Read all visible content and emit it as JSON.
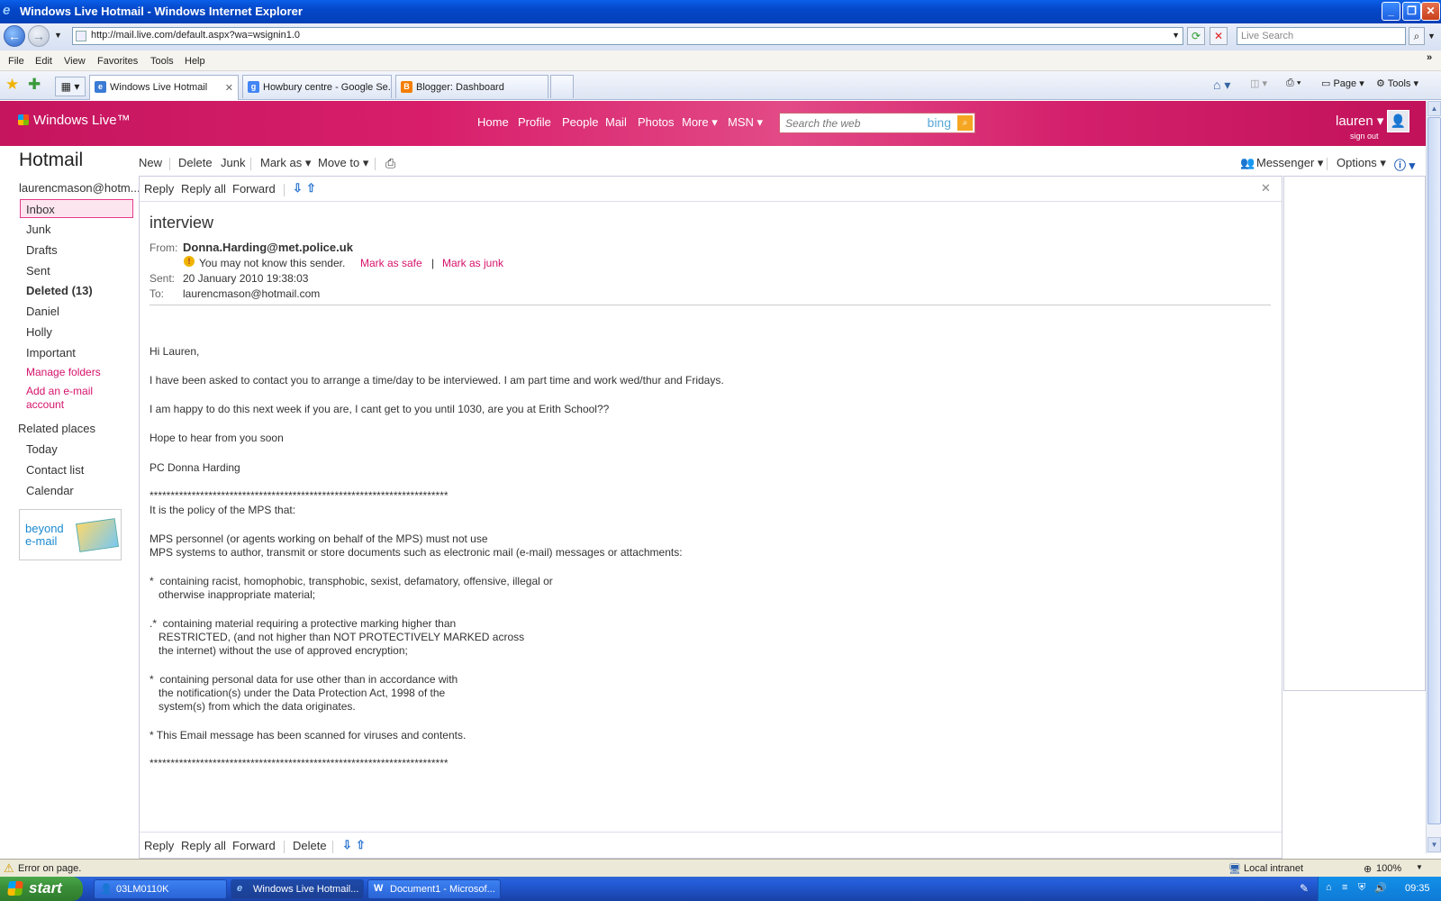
{
  "window": {
    "title": "Windows Live Hotmail - Windows Internet Explorer"
  },
  "address_bar": {
    "url": "http://mail.live.com/default.aspx?wa=wsignin1.0",
    "search_placeholder": "Live Search"
  },
  "menu": [
    "File",
    "Edit",
    "View",
    "Favorites",
    "Tools",
    "Help"
  ],
  "tabs": [
    {
      "label": "Windows Live Hotmail",
      "active": true
    },
    {
      "label": "Howbury centre - Google Se...",
      "active": false
    },
    {
      "label": "Blogger: Dashboard",
      "active": false
    }
  ],
  "ie_tools": {
    "page": "Page",
    "tools": "Tools"
  },
  "header": {
    "brand": "Windows Live™",
    "nav": [
      "Home",
      "Profile",
      "People",
      "Mail",
      "Photos",
      "More ▾",
      "MSN ▾"
    ],
    "search_placeholder": "Search the web",
    "bing": "bing",
    "user": "lauren ▾",
    "sign_out": "sign out"
  },
  "sidebar": {
    "title": "Hotmail",
    "account": "laurencmason@hotm...",
    "folders": [
      "Inbox",
      "Junk",
      "Drafts",
      "Sent",
      "Deleted (13)",
      "Daniel",
      "Holly",
      "Important"
    ],
    "links": [
      "Manage folders",
      "Add an e-mail",
      "account"
    ],
    "related_title": "Related places",
    "related": [
      "Today",
      "Contact list",
      "Calendar"
    ],
    "promo_line1": "beyond",
    "promo_line2": "e-mail"
  },
  "toolbar": {
    "new": "New",
    "delete": "Delete",
    "junk": "Junk",
    "mark_as": "Mark as ▾",
    "move_to": "Move to ▾",
    "messenger": "Messenger ▾",
    "options": "Options ▾"
  },
  "read_actions": {
    "reply": "Reply",
    "reply_all": "Reply all",
    "forward": "Forward",
    "delete": "Delete"
  },
  "message": {
    "subject": "interview",
    "from_label": "From:",
    "from": "Donna.Harding@met.police.uk",
    "warning": "You may not know this sender.",
    "mark_safe": "Mark as safe",
    "mark_junk": "Mark as junk",
    "sent_label": "Sent:",
    "sent": "20 January 2010 19:38:03",
    "to_label": "To:",
    "to": "laurencmason@hotmail.com",
    "greeting": "Hi Lauren,",
    "p1": "I have been asked to contact you to arrange a time/day to be interviewed. I am part time and work wed/thur and Fridays.",
    "p2": "I am happy to do this next week if you are, I cant get to you until 1030, are you at Erith School??",
    "p3": "Hope to hear from you soon",
    "signature": "PC Donna Harding",
    "stars": "***********************************************************************",
    "policy_intro": "It is the policy of the MPS that:",
    "policy_a1": "MPS personnel (or agents working on behalf of the MPS) must not use",
    "policy_a2": "MPS systems to author, transmit or store documents such as electronic mail (e-mail) messages or attachments:",
    "b1_1": "*  containing racist, homophobic, transphobic, sexist, defamatory, offensive, illegal or",
    "b1_2": "   otherwise inappropriate material;",
    "b2_1": ".*  containing material requiring a protective marking higher than",
    "b2_2": "   RESTRICTED, (and not higher than NOT PROTECTIVELY MARKED across",
    "b2_3": "   the internet) without the use of approved encryption;",
    "b3_1": "*  containing personal data for use other than in accordance with",
    "b3_2": "   the notification(s) under the Data Protection Act, 1998 of the",
    "b3_3": "   system(s) from which the data originates.",
    "scan": "* This Email message has been scanned for viruses and contents."
  },
  "status_bar": {
    "left": "Error on page.",
    "zone": "Local intranet",
    "zoom": "100%"
  },
  "taskbar": {
    "start": "start",
    "items": [
      "03LM0110K",
      "Windows Live Hotmail...",
      "Document1 - Microsof..."
    ],
    "clock": "09:35"
  }
}
